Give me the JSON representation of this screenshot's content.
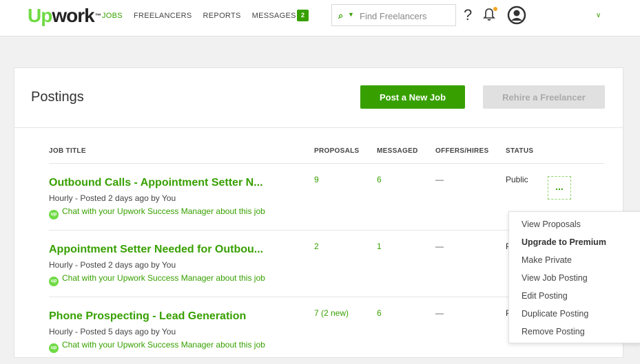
{
  "brand": {
    "logo_up": "Up",
    "logo_work": "work",
    "tm": "™"
  },
  "nav": {
    "items": [
      "JOBS",
      "FREELANCERS",
      "REPORTS",
      "MESSAGES"
    ],
    "active": "JOBS",
    "messages_badge": "2"
  },
  "search": {
    "placeholder": "Find Freelancers"
  },
  "header_icons": {
    "help": "?",
    "accent": "#37a000",
    "notification_dot": "#f5a623"
  },
  "page": {
    "title": "Postings",
    "post_button": "Post a New Job",
    "rehire_button": "Rehire a Freelancer"
  },
  "table": {
    "columns": [
      "JOB TITLE",
      "PROPOSALS",
      "MESSAGED",
      "OFFERS/HIRES",
      "STATUS"
    ],
    "rows": [
      {
        "title": "Outbound Calls - Appointment Setter N...",
        "meta": "Hourly - Posted 2 days ago by You",
        "chat": "Chat with your Upwork Success Manager about this job",
        "proposals": "9",
        "messaged": "6",
        "offers": "—",
        "status": "Public"
      },
      {
        "title": "Appointment Setter Needed for Outbou...",
        "meta": "Hourly - Posted 2 days ago by You",
        "chat": "Chat with your Upwork Success Manager about this job",
        "proposals": "2",
        "messaged": "1",
        "offers": "—",
        "status": "P"
      },
      {
        "title": "Phone Prospecting - Lead Generation",
        "meta": "Hourly - Posted 5 days ago by You",
        "chat": "Chat with your Upwork Success Manager about this job",
        "proposals": "7 (2 new)",
        "messaged": "6",
        "offers": "—",
        "status": "P"
      }
    ]
  },
  "actions_menu": {
    "button": "...",
    "items": [
      "View Proposals",
      "Upgrade to Premium",
      "Make Private",
      "View Job Posting",
      "Edit Posting",
      "Duplicate Posting",
      "Remove Posting"
    ]
  }
}
